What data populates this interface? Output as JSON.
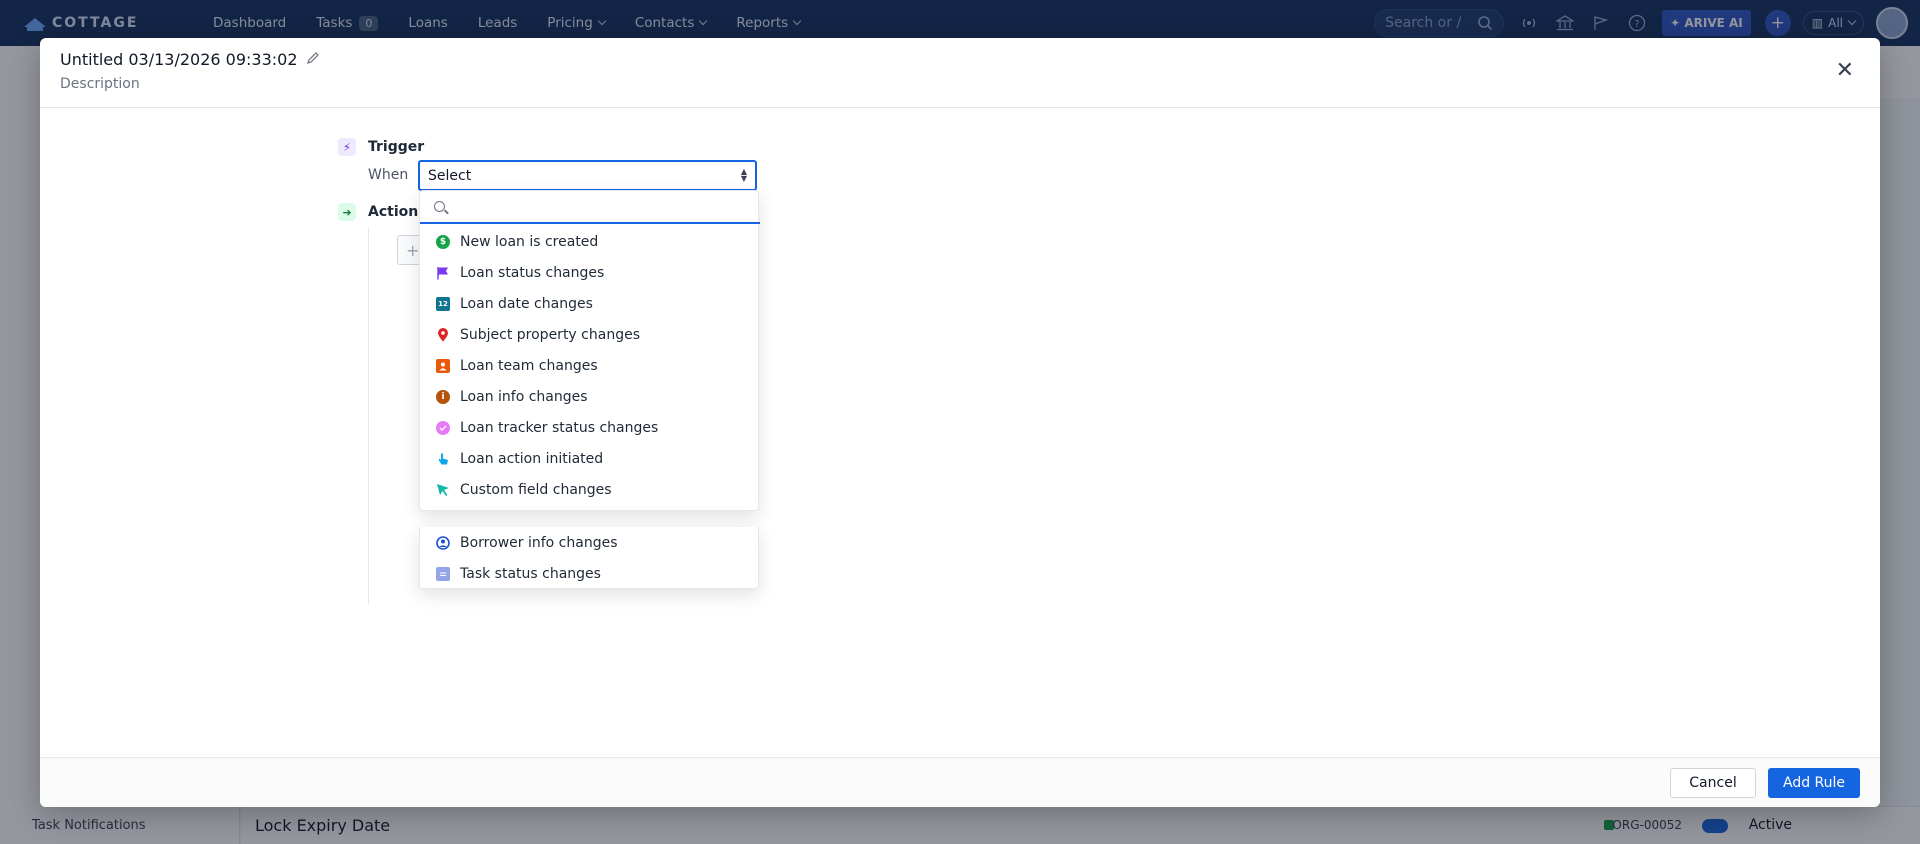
{
  "topbar": {
    "logo": "COTTAGE",
    "nav": [
      {
        "label": "Dashboard"
      },
      {
        "label": "Tasks",
        "badge": "0"
      },
      {
        "label": "Loans"
      },
      {
        "label": "Leads"
      },
      {
        "label": "Pricing",
        "dropdown": true
      },
      {
        "label": "Contacts",
        "dropdown": true
      },
      {
        "label": "Reports",
        "dropdown": true
      }
    ],
    "search_placeholder": "Search or /",
    "arive_ai": "ARIVE AI",
    "scope": "All"
  },
  "background": {
    "sidebar_bottom_item": "Task Notifications",
    "footer_title": "Lock Expiry Date",
    "org_id": "ORG-00052",
    "status": "Active"
  },
  "modal": {
    "title": "Untitled 03/13/2026 09:33:02",
    "description": "Description",
    "trigger": {
      "label": "Trigger",
      "when_label": "When",
      "select_value": "Select"
    },
    "actions_label": "Actions",
    "dropdown": {
      "search_value": "",
      "options": [
        {
          "label": "New loan is created",
          "icon": "dollar-icon",
          "color": "#16a34a"
        },
        {
          "label": "Loan status changes",
          "icon": "flag-icon",
          "color": "#7c3aed"
        },
        {
          "label": "Loan date changes",
          "icon": "calendar-icon",
          "color": "#0e7490"
        },
        {
          "label": "Subject property changes",
          "icon": "map-pin-icon",
          "color": "#dc2626"
        },
        {
          "label": "Loan team changes",
          "icon": "team-icon",
          "color": "#ea580c"
        },
        {
          "label": "Loan info changes",
          "icon": "info-icon",
          "color": "#b45309"
        },
        {
          "label": "Loan tracker status changes",
          "icon": "tracker-icon",
          "color": "#e879f9"
        },
        {
          "label": "Loan action initiated",
          "icon": "hand-pointer-icon",
          "color": "#0ea5e9"
        },
        {
          "label": "Custom field changes",
          "icon": "cursor-icon",
          "color": "#14b8a6"
        },
        {
          "label": "Borrower info changes",
          "icon": "user-circle-icon",
          "color": "#1d4ed8"
        },
        {
          "label": "Task status changes",
          "icon": "clipboard-icon",
          "color": "#93a5e8"
        }
      ]
    },
    "footer": {
      "cancel": "Cancel",
      "add_rule": "Add Rule"
    }
  }
}
